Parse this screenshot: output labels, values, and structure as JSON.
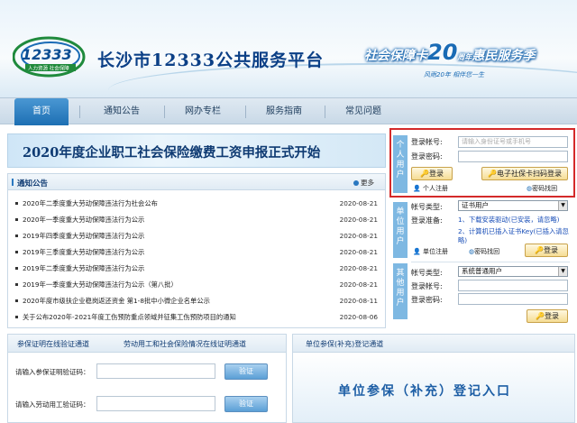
{
  "header": {
    "logo_number": "12333",
    "logo_sub": "人力资源 社会保障",
    "site_title": "长沙市12333公共服务平台",
    "slogan_left": "社会保障卡",
    "slogan_num": "20",
    "slogan_mid": "周年",
    "slogan_right": "惠民服务季",
    "slogan_sub": "风雨20年 相伴您一生"
  },
  "nav": {
    "items": [
      "首页",
      "通知公告",
      "网办专栏",
      "服务指南",
      "常见问题"
    ]
  },
  "banner": {
    "text": "2020年度企业职工社会保险缴费工资申报正式开始"
  },
  "notice": {
    "title": "通知公告",
    "more": "更多",
    "items": [
      {
        "title": "2020年二季度重大劳动保障违法行为社会公布",
        "date": "2020-08-21"
      },
      {
        "title": "2020年一季度重大劳动保障违法行为公示",
        "date": "2020-08-21"
      },
      {
        "title": "2019年四季度重大劳动保障违法行为公示",
        "date": "2020-08-21"
      },
      {
        "title": "2019年三季度重大劳动保障违法行为公示",
        "date": "2020-08-21"
      },
      {
        "title": "2019年二季度重大劳动保障违法行为公示",
        "date": "2020-08-21"
      },
      {
        "title": "2019年一季度重大劳动保障违法行为公示（第八批）",
        "date": "2020-08-21"
      },
      {
        "title": "2020年度市级扶企业稳岗返还资金 第1-8批中小微企业名单公示",
        "date": "2020-08-11"
      },
      {
        "title": "关于公布2020年-2021年度工伤预防重点领域并征集工伤预防项目的通知",
        "date": "2020-08-06"
      }
    ]
  },
  "personal": {
    "tab": "个人用户",
    "account_label": "登录帐号:",
    "account_placeholder": "请输入身份证号或手机号",
    "password_label": "登录密码:",
    "login": "登录",
    "scan_login": "电子社保卡扫码登录",
    "register": "个人注册",
    "recover": "密码找回"
  },
  "unit": {
    "tab": "单位用户",
    "type_label": "帐号类型:",
    "type_value": "证书用户",
    "prep_label": "登录准备:",
    "step1": "1、下载安装驱动(已安装，请忽略)",
    "step2": "2、计算机已插入证书Key(已插入请忽略)",
    "register": "单位注册",
    "recover": "密码找回",
    "login": "登录"
  },
  "other": {
    "tab": "其他用户",
    "type_label": "帐号类型:",
    "type_value": "系统普通用户",
    "account_label": "登录帐号:",
    "password_label": "登录密码:",
    "login": "登录"
  },
  "bottom_left": {
    "tab1": "参保证明在线验证通道",
    "tab2": "劳动用工和社会保险情况在线证明通道",
    "code1_label": "请输入参保证明验证码：",
    "code2_label": "请输入劳动用工验证码：",
    "verify": "验证"
  },
  "bottom_right": {
    "title": "单位参保(补充)登记通道",
    "entry": "单位参保（补充）登记入口"
  }
}
